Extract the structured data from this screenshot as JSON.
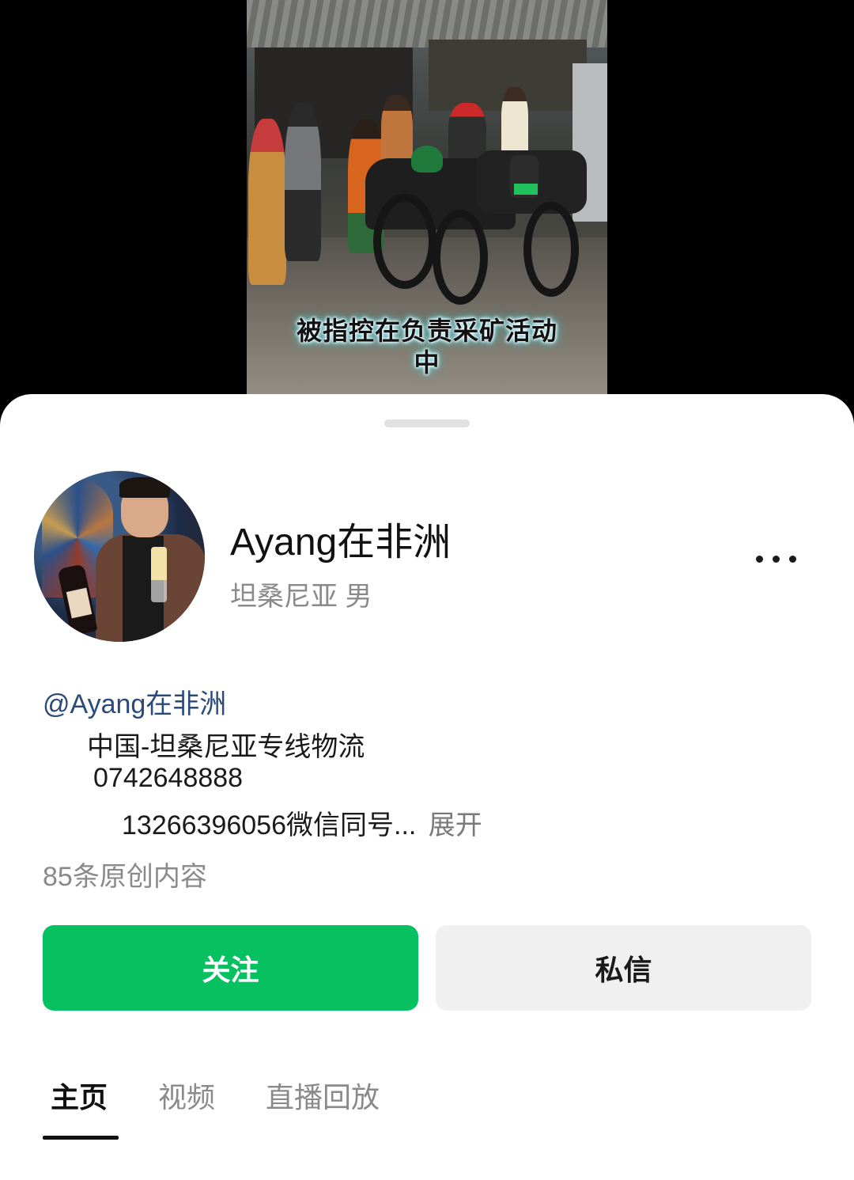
{
  "video": {
    "caption_line1": "被指控在负责采矿活动",
    "caption_line2": "中"
  },
  "profile": {
    "name": "Ayang在非洲",
    "location_gender": "坦桑尼亚 男",
    "mention": "@Ayang在非洲",
    "bio_line1": "中国-坦桑尼亚专线物流",
    "bio_line2": "0742648888",
    "bio_line3": "13266396056微信同号...",
    "expand_label": "展开",
    "original_count": "85条原创内容"
  },
  "actions": {
    "follow_label": "关注",
    "message_label": "私信"
  },
  "tabs": [
    {
      "label": "主页",
      "active": true
    },
    {
      "label": "视频",
      "active": false
    },
    {
      "label": "直播回放",
      "active": false
    }
  ],
  "icons": {
    "more": "more-options-icon"
  },
  "colors": {
    "follow_green": "#07c160",
    "mention_blue": "#2a4a7a"
  }
}
